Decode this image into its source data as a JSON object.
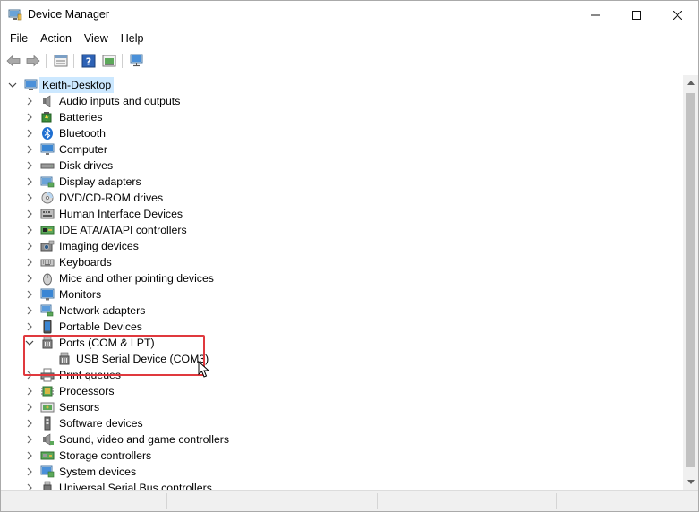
{
  "window": {
    "title": "Device Manager"
  },
  "menu": {
    "items": [
      "File",
      "Action",
      "View",
      "Help"
    ]
  },
  "toolbar": {
    "buttons": [
      "back-icon",
      "forward-icon",
      "properties-icon",
      "help-icon",
      "update-driver-icon",
      "scan-hardware-icon"
    ]
  },
  "tree": {
    "root": "Keith-Desktop",
    "categories": [
      {
        "label": "Audio inputs and outputs",
        "icon": "speaker-icon"
      },
      {
        "label": "Batteries",
        "icon": "battery-icon"
      },
      {
        "label": "Bluetooth",
        "icon": "bluetooth-icon"
      },
      {
        "label": "Computer",
        "icon": "computer-icon"
      },
      {
        "label": "Disk drives",
        "icon": "disk-drive-icon"
      },
      {
        "label": "Display adapters",
        "icon": "display-adapter-icon"
      },
      {
        "label": "DVD/CD-ROM drives",
        "icon": "dvd-drive-icon"
      },
      {
        "label": "Human Interface Devices",
        "icon": "hid-icon"
      },
      {
        "label": "IDE ATA/ATAPI controllers",
        "icon": "ide-controller-icon"
      },
      {
        "label": "Imaging devices",
        "icon": "camera-icon"
      },
      {
        "label": "Keyboards",
        "icon": "keyboard-icon"
      },
      {
        "label": "Mice and other pointing devices",
        "icon": "mouse-icon"
      },
      {
        "label": "Monitors",
        "icon": "monitor-icon"
      },
      {
        "label": "Network adapters",
        "icon": "network-adapter-icon"
      },
      {
        "label": "Portable Devices",
        "icon": "portable-device-icon"
      },
      {
        "label": "Ports (COM & LPT)",
        "icon": "port-icon",
        "expanded": true,
        "children": [
          {
            "label": "USB Serial Device (COM3)",
            "icon": "port-icon"
          }
        ]
      },
      {
        "label": "Print queues",
        "icon": "printer-icon"
      },
      {
        "label": "Processors",
        "icon": "processor-icon"
      },
      {
        "label": "Sensors",
        "icon": "sensor-icon"
      },
      {
        "label": "Software devices",
        "icon": "software-device-icon"
      },
      {
        "label": "Sound, video and game controllers",
        "icon": "sound-controller-icon"
      },
      {
        "label": "Storage controllers",
        "icon": "storage-controller-icon"
      },
      {
        "label": "System devices",
        "icon": "system-device-icon"
      },
      {
        "label": "Universal Serial Bus controllers",
        "icon": "usb-controller-icon"
      }
    ]
  },
  "colors": {
    "selection": "#cce8ff",
    "highlight_box": "#e0393e",
    "scrollbar_track": "#f0f0f0",
    "scrollbar_thumb": "#c1c1c1"
  }
}
